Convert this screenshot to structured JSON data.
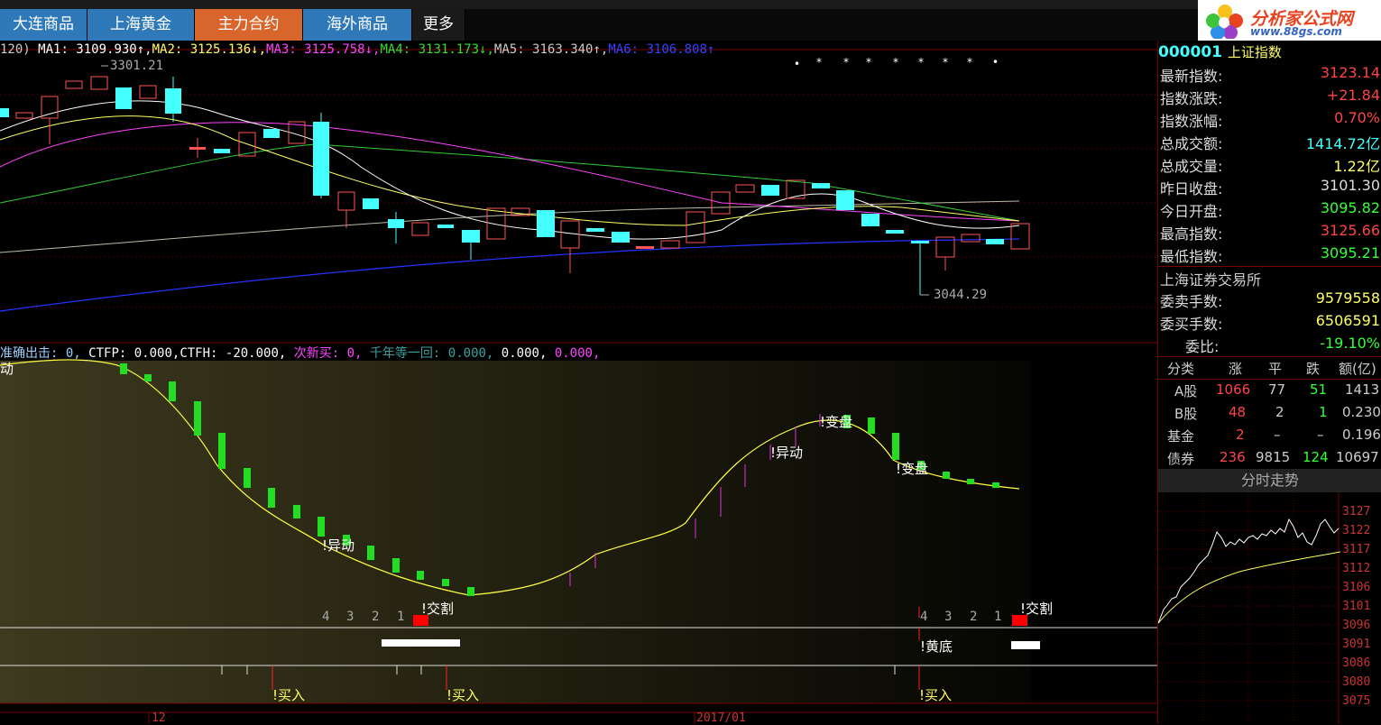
{
  "tabs": [
    {
      "label": "大连商品",
      "style": "blue"
    },
    {
      "label": "上海黄金",
      "style": "blue"
    },
    {
      "label": "主力合约",
      "style": "orange"
    },
    {
      "label": "海外商品",
      "style": "blue"
    },
    {
      "label": "更多",
      "style": "dark"
    }
  ],
  "logo": {
    "title": "分析家公式网",
    "url": "www.88gs.com"
  },
  "ma_line": {
    "prefix": "120)",
    "items": [
      {
        "text": "MA1: 3109.930↑,",
        "color": "#ffffff"
      },
      {
        "text": "MA2: 3125.136↓,",
        "color": "#ffff66"
      },
      {
        "text": "MA3: 3125.758↓,",
        "color": "#ff44ff"
      },
      {
        "text": "MA4: 3131.173↓,",
        "color": "#33dd33"
      },
      {
        "text": "MA5: 3163.340↑,",
        "color": "#cccccc"
      },
      {
        "text": "MA6: 3106.808↑",
        "color": "#3344ff"
      }
    ]
  },
  "price_labels": {
    "high": "3301.21",
    "low": "3044.29"
  },
  "indicator_line": {
    "items": [
      {
        "text": "准确出击: 0,",
        "color": "#9ad0ff"
      },
      {
        "text": "CTFP: 0.000,",
        "color": "#ffffff"
      },
      {
        "text": "CTFH: -20.000,",
        "color": "#ffffff"
      },
      {
        "text": "次新买: 0,",
        "color": "#ff44ff"
      },
      {
        "text": "千年等一回: 0.000,",
        "color": "#3aa0a0"
      },
      {
        "text": "0.000,",
        "color": "#ffffff"
      },
      {
        "text": "0.000,",
        "color": "#ff44ff"
      }
    ]
  },
  "signals": {
    "yidong": "!异动",
    "biandan": "!变盘",
    "jiaoge": "!交割",
    "huangdi": "!黄底",
    "mairu": "!买入",
    "dong_partial": "动",
    "countdown": [
      "4",
      "3",
      "2",
      "1"
    ]
  },
  "x_axis": {
    "month1": "12",
    "month2": "2017/01"
  },
  "panel": {
    "code": "000001",
    "name": "上证指数",
    "rows": [
      {
        "label": "最新指数:",
        "value": "3123.14",
        "color": "#ff4444"
      },
      {
        "label": "指数涨跌:",
        "value": "+21.84",
        "color": "#ff4444"
      },
      {
        "label": "指数涨幅:",
        "value": "0.70%",
        "color": "#ff4444"
      },
      {
        "label": "总成交额:",
        "value": "1414.72亿",
        "color": "#44ffff"
      },
      {
        "label": "总成交量:",
        "value": "1.22亿",
        "color": "#ffff66"
      },
      {
        "label": "昨日收盘:",
        "value": "3101.30",
        "color": "#dddddd"
      },
      {
        "label": "今日开盘:",
        "value": "3095.82",
        "color": "#33ff33"
      },
      {
        "label": "最高指数:",
        "value": "3125.66",
        "color": "#ff4444"
      },
      {
        "label": "最低指数:",
        "value": "3095.21",
        "color": "#33ff33"
      }
    ],
    "exchange": "上海证券交易所",
    "rows2": [
      {
        "label": "委卖手数:",
        "value": "9579558",
        "color": "#ffff66"
      },
      {
        "label": "委买手数:",
        "value": "6506591",
        "color": "#ffff66"
      },
      {
        "label": "委比:",
        "value": "-19.10%",
        "color": "#33ff33"
      }
    ],
    "table": {
      "headers": [
        "分类",
        "涨",
        "平",
        "跌",
        "额(亿)"
      ],
      "rows": [
        [
          "A股",
          "1066",
          "77",
          "51",
          "1413"
        ],
        [
          "B股",
          "48",
          "2",
          "1",
          "0.230"
        ],
        [
          "基金",
          "2",
          "–",
          "–",
          "0.196"
        ],
        [
          "债券",
          "236",
          "9815",
          "124",
          "10697"
        ]
      ]
    },
    "mini_title": "分时走势",
    "mini_axis": [
      "3127",
      "3122",
      "3117",
      "3112",
      "3106",
      "3101",
      "3096",
      "3091",
      "3086",
      "3080",
      "3075"
    ]
  }
}
